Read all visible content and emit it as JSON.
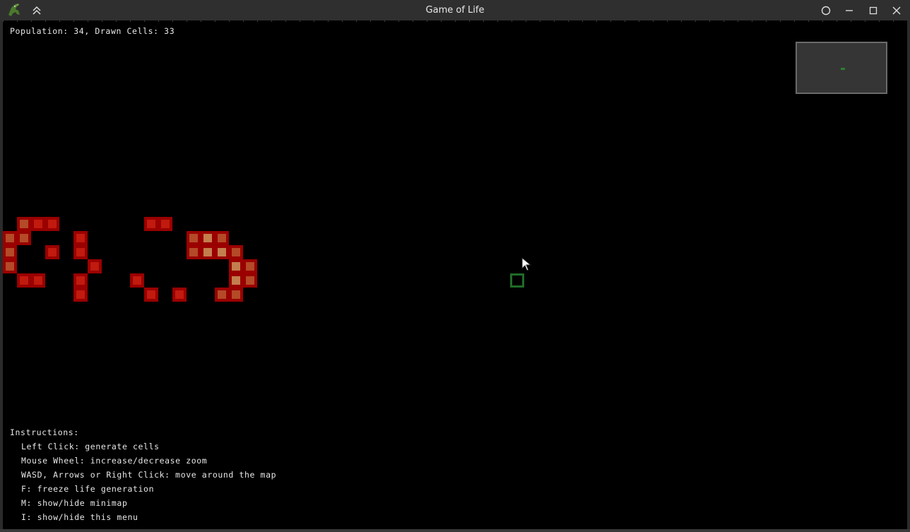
{
  "window": {
    "title": "Game of Life"
  },
  "hud": {
    "status": "Population: 34, Drawn Cells: 33"
  },
  "instructions": {
    "heading": "Instructions:",
    "items": [
      "Left Click: generate cells",
      "Mouse Wheel: increase/decrease zoom",
      "WASD, Arrows or Right Click: move around the map",
      "F: freeze life generation",
      "M: show/hide minimap",
      "I: show/hide this menu"
    ]
  },
  "board": {
    "cell_colors": {
      "border": "#9a0000",
      "fill_red": "#c11a0e",
      "fill_mid": "#b44a28",
      "fill_light": "#c47e4e"
    },
    "cells": [
      {
        "col": 1,
        "row": 0,
        "shade": "mid"
      },
      {
        "col": 2,
        "row": 0,
        "shade": "red"
      },
      {
        "col": 3,
        "row": 0,
        "shade": "red"
      },
      {
        "col": 0,
        "row": 1,
        "shade": "mid"
      },
      {
        "col": 1,
        "row": 1,
        "shade": "mid"
      },
      {
        "col": 0,
        "row": 2,
        "shade": "mid"
      },
      {
        "col": 3,
        "row": 2,
        "shade": "dark"
      },
      {
        "col": 0,
        "row": 3,
        "shade": "mid"
      },
      {
        "col": 1,
        "row": 4,
        "shade": "red"
      },
      {
        "col": 2,
        "row": 4,
        "shade": "red"
      },
      {
        "col": 5,
        "row": 1,
        "shade": "red"
      },
      {
        "col": 5,
        "row": 2,
        "shade": "red"
      },
      {
        "col": 6,
        "row": 3,
        "shade": "red"
      },
      {
        "col": 5,
        "row": 4,
        "shade": "red"
      },
      {
        "col": 5,
        "row": 5,
        "shade": "red"
      },
      {
        "col": 10,
        "row": 0,
        "shade": "red"
      },
      {
        "col": 11,
        "row": 0,
        "shade": "red"
      },
      {
        "col": 9,
        "row": 4,
        "shade": "red"
      },
      {
        "col": 10,
        "row": 5,
        "shade": "red"
      },
      {
        "col": 12,
        "row": 5,
        "shade": "dark"
      },
      {
        "col": 13,
        "row": 1,
        "shade": "mid"
      },
      {
        "col": 14,
        "row": 1,
        "shade": "light"
      },
      {
        "col": 15,
        "row": 1,
        "shade": "mid"
      },
      {
        "col": 13,
        "row": 2,
        "shade": "mid"
      },
      {
        "col": 14,
        "row": 2,
        "shade": "light"
      },
      {
        "col": 15,
        "row": 2,
        "shade": "light"
      },
      {
        "col": 16,
        "row": 2,
        "shade": "mid"
      },
      {
        "col": 16,
        "row": 3,
        "shade": "light"
      },
      {
        "col": 17,
        "row": 3,
        "shade": "mid"
      },
      {
        "col": 16,
        "row": 4,
        "shade": "light"
      },
      {
        "col": 17,
        "row": 4,
        "shade": "mid"
      },
      {
        "col": 15,
        "row": 5,
        "shade": "mid"
      },
      {
        "col": 16,
        "row": 5,
        "shade": "mid"
      }
    ]
  },
  "minimap": {
    "background": "#353535",
    "marker_color": "#2e7d32"
  },
  "hover_cell_color": "#1f6b27"
}
